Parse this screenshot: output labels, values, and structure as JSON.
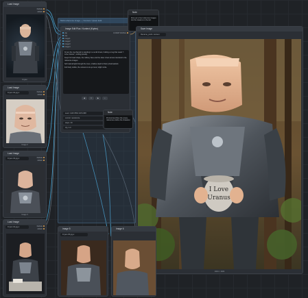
{
  "colors": {
    "canvas": "#1f2226",
    "node": "#2b2f35",
    "wire_blue": "#4aa8d8",
    "wire_gray": "#5d6670",
    "accent_orange": "#e6a855"
  },
  "nodes": {
    "load1": {
      "title": "Load Image",
      "inputs": [
        "IMAGE",
        "MASK"
      ],
      "widget": "Kryten 01.jpg ▾",
      "caption": "Kryten"
    },
    "load2": {
      "title": "Load Image",
      "inputs": [
        "IMAGE",
        "MASK"
      ],
      "widget": "Kryten 02.jpg ▾",
      "caption": "Image 2"
    },
    "load3": {
      "title": "Load Image",
      "inputs": [
        "IMAGE",
        "MASK"
      ],
      "widget": "Kryten 03.jpg ▾",
      "caption": "Image 3"
    },
    "load4": {
      "title": "Load Image",
      "inputs": [
        "IMAGE",
        "MASK"
      ],
      "widget": "Kryten 04.jpg ▾",
      "caption": "Image 4"
    },
    "group": {
      "label": "Multi-reference image — Kontext / Qwen Edit"
    },
    "edit": {
      "title": "Image Edit Plus / Kontext (Kryten)",
      "inputs": [
        "clip",
        "vae",
        "image1",
        "image2",
        "image3",
        "image4"
      ],
      "output": "CONDITIONING",
      "prompt_paragraphs": [
        "Kryten the mechanoid is standing in a sunlit forest, holding a mug that reads \"I Love Uranus\", smiling proudly.",
        "Keep his head shape, the rubbery face and the silver chest armour identical to the reference images.",
        "Soft natural light through the trees, shallow depth of field, photorealistic.",
        "Full body visible, the camera is at eye level, slight smile."
      ],
      "controls": [
        "◀",
        "1",
        "▶",
        "▪"
      ],
      "fields": [
        {
          "label": "seed",
          "value": "1103 0561 445 2468"
        },
        {
          "label": "control",
          "value": "randomize"
        },
        {
          "label": "steps",
          "value": "20"
        },
        {
          "label": "cfg",
          "value": "4.0"
        }
      ]
    },
    "note_top": {
      "title": "Note",
      "text": "Drop up to four reference images into the loaders on the left."
    },
    "note_mid": {
      "title": "Note",
      "text": "Prompt describes the scene, references define the character."
    },
    "preview": {
      "title": "Save Image",
      "prefix_label": "filename_prefix",
      "prefix_value": "kontext",
      "caption": "1024 × 1024",
      "mug_line1": "I Love",
      "mug_line2": "Uranus"
    },
    "image5": {
      "title": "Image 5",
      "widget": "Kryten 05.jpg ▾"
    },
    "image6": {
      "title": "Image 6"
    }
  }
}
